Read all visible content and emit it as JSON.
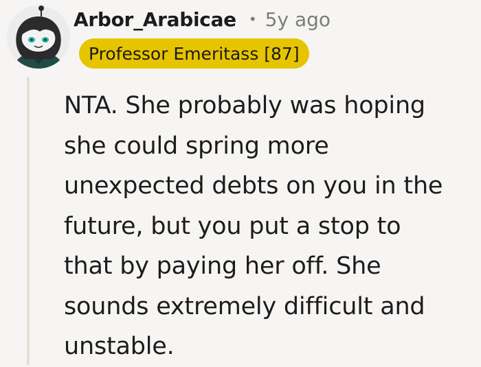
{
  "comment": {
    "author": "Arbor_Arabicae",
    "separator": "•",
    "age": "5y ago",
    "flair": "Professor Emeritass [87]",
    "flair_color": "#e7c400",
    "avatar": "snoo-avatar-icon",
    "body_lines": [
      "NTA. She probably was hoping",
      "she could spring more",
      "unexpected debts on you in the",
      "future, but you put a stop to",
      "that by paying her off. She",
      "sounds extremely difficult and",
      "unstable."
    ]
  }
}
